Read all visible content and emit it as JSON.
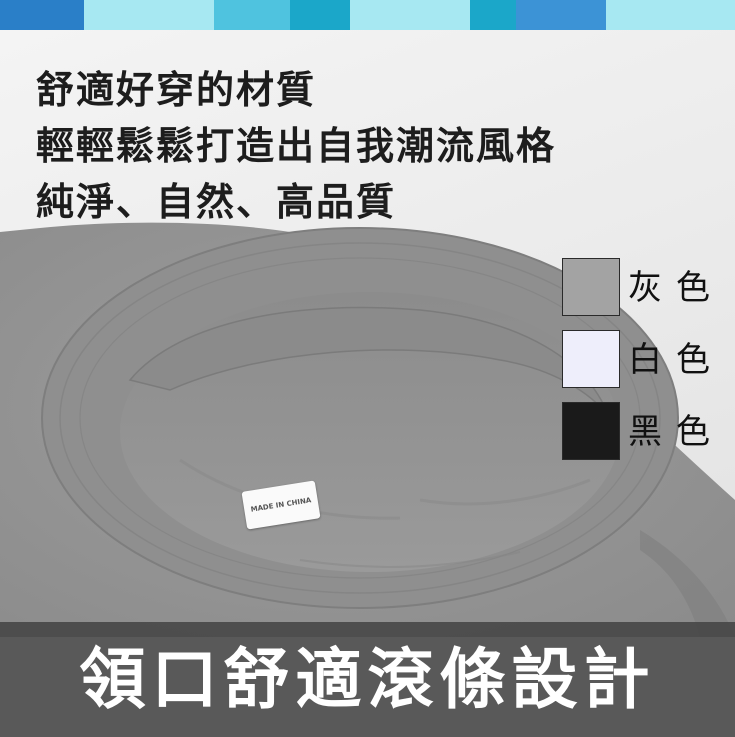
{
  "top_bar": {
    "colors": [
      "#2a7fc8",
      "#5ec9e8",
      "#a7e8f2",
      "#1ba7c9",
      "#3c93d6"
    ]
  },
  "headline": {
    "line1": "舒適好穿的材質",
    "line2": "輕輕鬆鬆打造出自我潮流風格",
    "line3": "純淨、自然、高品質"
  },
  "tag": {
    "text": "MADE IN CHINA"
  },
  "swatches": [
    {
      "label": "灰色",
      "color": "#a3a3a3"
    },
    {
      "label": "白色",
      "color": "#eeeefb"
    },
    {
      "label": "黑色",
      "color": "#1a1a1a"
    }
  ],
  "banner": {
    "text": "領口舒適滾條設計"
  }
}
